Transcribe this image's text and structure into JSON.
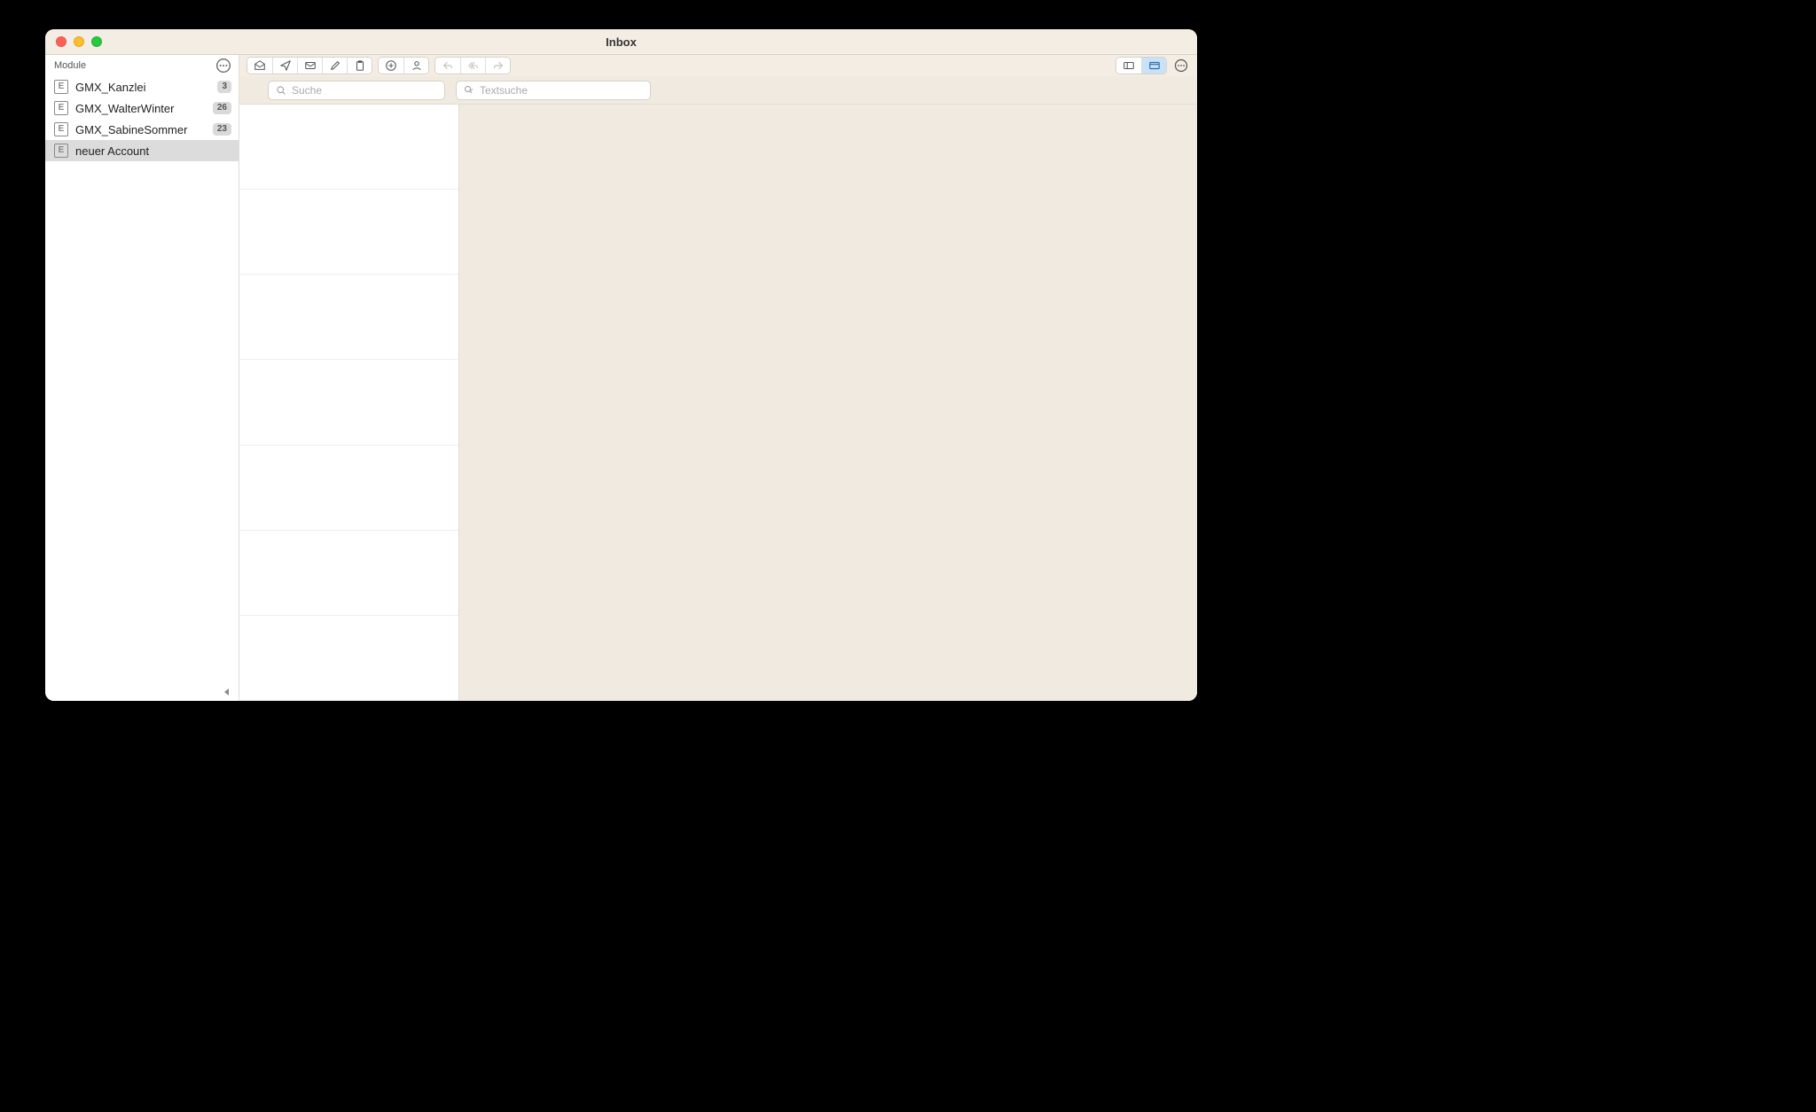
{
  "window": {
    "title": "Inbox"
  },
  "sidebar": {
    "header_label": "Module",
    "accounts": [
      {
        "icon": "E",
        "label": "GMX_Kanzlei",
        "badge": "3",
        "selected": false
      },
      {
        "icon": "E",
        "label": "GMX_WalterWinter",
        "badge": "26",
        "selected": false
      },
      {
        "icon": "E",
        "label": "GMX_SabineSommer",
        "badge": "23",
        "selected": false
      },
      {
        "icon": "E",
        "label": "neuer Account",
        "badge": "",
        "selected": true
      }
    ]
  },
  "search": {
    "placeholder_main": "Suche",
    "placeholder_text": "Textsuche"
  },
  "message_list": {
    "empty_rows": 7
  }
}
